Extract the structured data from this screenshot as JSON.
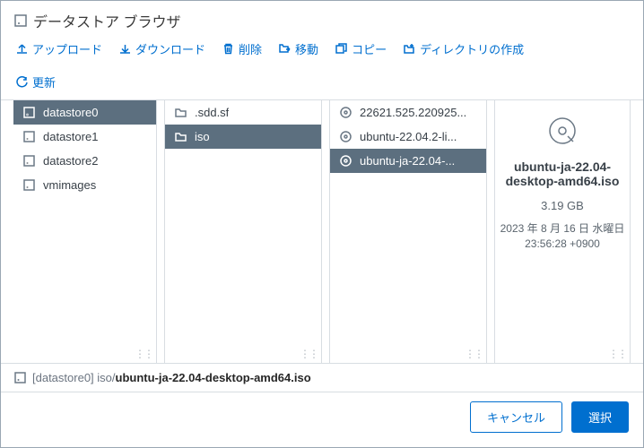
{
  "title": "データストア ブラウザ",
  "toolbar": {
    "upload": "アップロード",
    "download": "ダウンロード",
    "delete": "削除",
    "move": "移動",
    "copy": "コピー",
    "newFolder": "ディレクトリの作成",
    "refresh": "更新"
  },
  "columns": {
    "datastores": [
      {
        "label": "datastore0",
        "selected": true
      },
      {
        "label": "datastore1",
        "selected": false
      },
      {
        "label": "datastore2",
        "selected": false
      },
      {
        "label": "vmimages",
        "selected": false
      }
    ],
    "folders": [
      {
        "label": ".sdd.sf",
        "selected": false
      },
      {
        "label": "iso",
        "selected": true
      }
    ],
    "files": [
      {
        "label": "22621.525.220925...",
        "selected": false
      },
      {
        "label": "ubuntu-22.04.2-li...",
        "selected": false
      },
      {
        "label": "ubuntu-ja-22.04-...",
        "selected": true
      }
    ]
  },
  "details": {
    "name": "ubuntu-ja-22.04-desktop-amd64.iso",
    "size": "3.19 GB",
    "date_line1": "2023 年 8 月 16 日 水曜日",
    "date_line2": "23:56:28 +0900"
  },
  "path": {
    "datastore": "[datastore0]",
    "folder": "iso/",
    "file": "ubuntu-ja-22.04-desktop-amd64.iso"
  },
  "footer": {
    "cancel": "キャンセル",
    "select": "選択"
  }
}
